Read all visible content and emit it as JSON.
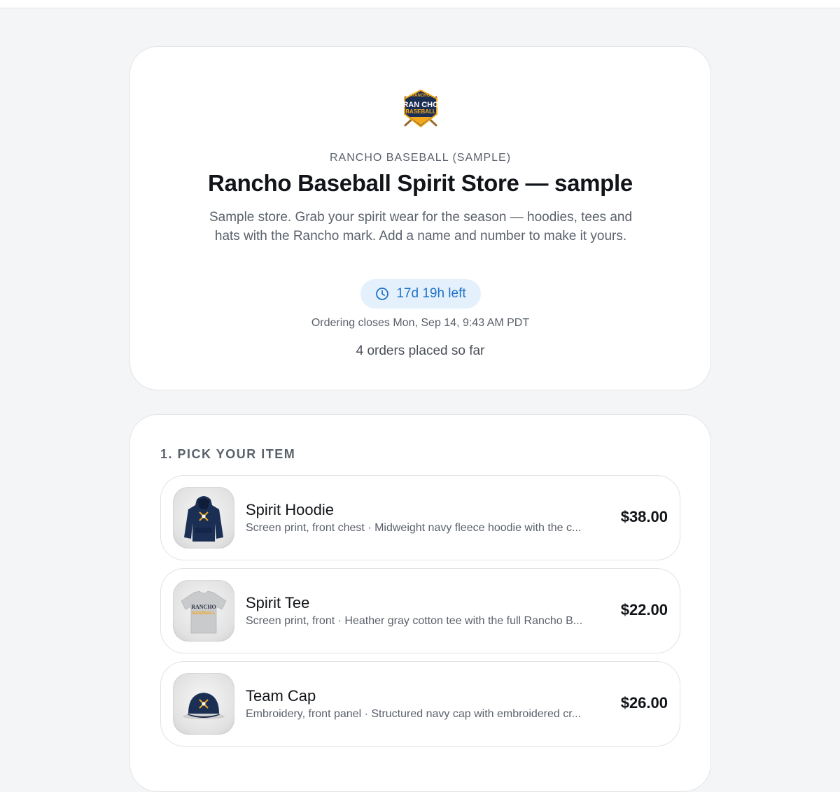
{
  "store": {
    "org_name": "RANCHO BASEBALL (SAMPLE)",
    "title": "Rancho Baseball Spirit Store — sample",
    "description": "Sample store. Grab your spirit wear for the season — hoodies, tees and hats with the Rancho mark. Add a name and number to make it yours.",
    "countdown": "17d 19h left",
    "closes": "Ordering closes Mon, Sep 14, 9:43 AM PDT",
    "orders": "4 orders placed so far",
    "logo": {
      "top_text": "RANCHO",
      "line1": "RAN CHO",
      "line2": "BASEBALL"
    }
  },
  "picker": {
    "section_title": "1. PICK YOUR ITEM",
    "items": [
      {
        "name": "Spirit Hoodie",
        "description": "Screen print, front chest · Midweight navy fleece hoodie with the c...",
        "price": "$38.00",
        "icon": "hoodie-image"
      },
      {
        "name": "Spirit Tee",
        "description": "Screen print, front · Heather gray cotton tee with the full Rancho B...",
        "price": "$22.00",
        "icon": "tee-image",
        "print_text": "RANCHO",
        "print_text_2": "BASEBALL"
      },
      {
        "name": "Team Cap",
        "description": "Embroidery, front panel · Structured navy cap with embroidered cr...",
        "price": "$26.00",
        "icon": "cap-image"
      }
    ]
  },
  "colors": {
    "accent": "#1f72c6",
    "accent_bg": "#e4f1fd",
    "navy": "#1b2f55",
    "gold": "#f2a81d"
  }
}
